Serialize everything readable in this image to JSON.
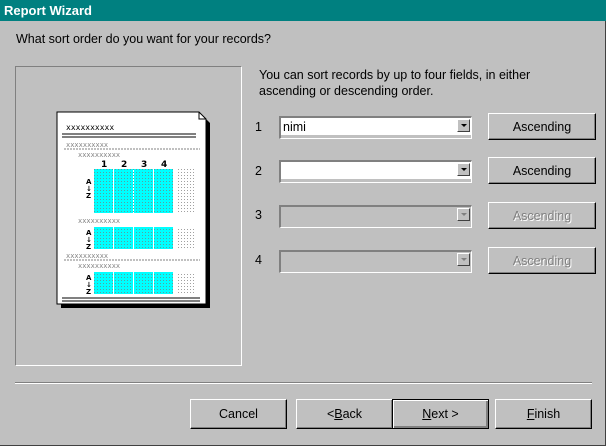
{
  "window": {
    "title": "Report Wizard"
  },
  "question": "What sort order do you want for your records?",
  "description": "You can sort records by up to four fields, in either ascending or descending order.",
  "sort_fields": [
    {
      "number": "1",
      "value": "nimi",
      "order": "Ascending",
      "enabled": true
    },
    {
      "number": "2",
      "value": "",
      "order": "Ascending",
      "enabled": true
    },
    {
      "number": "3",
      "value": "",
      "order": "Ascending",
      "enabled": false
    },
    {
      "number": "4",
      "value": "",
      "order": "Ascending",
      "enabled": false
    }
  ],
  "preview": {
    "column_numbers": [
      "1",
      "2",
      "3",
      "4"
    ],
    "placeholder_text": "xxxxxxxxxx",
    "sort_glyph": "A↓Z",
    "highlight_color": "#00ffff"
  },
  "buttons": {
    "cancel": "Cancel",
    "back_prefix": "< ",
    "back_mnemonic": "B",
    "back_rest": "ack",
    "next_mnemonic": "N",
    "next_rest": "ext >",
    "finish_mnemonic": "F",
    "finish_rest": "inish"
  }
}
